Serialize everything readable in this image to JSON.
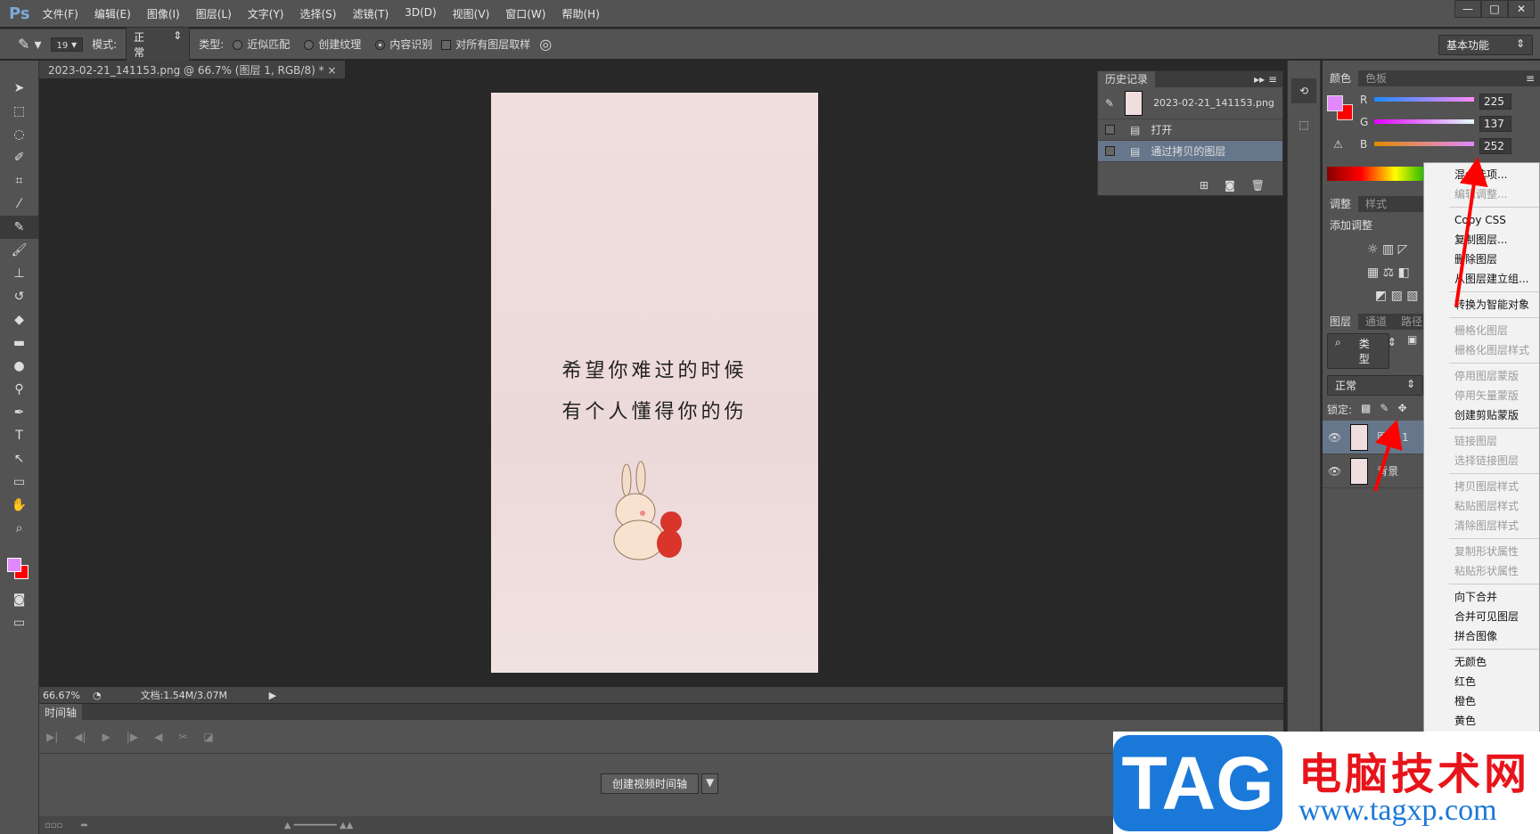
{
  "app": {
    "logo": "Ps",
    "menu": [
      "文件(F)",
      "编辑(E)",
      "图像(I)",
      "图层(L)",
      "文字(Y)",
      "选择(S)",
      "滤镜(T)",
      "3D(D)",
      "视图(V)",
      "窗口(W)",
      "帮助(H)"
    ],
    "window_buttons": [
      "—",
      "□",
      "✕"
    ]
  },
  "options": {
    "brush_size": "19",
    "mode_label": "模式:",
    "mode_value": "正常",
    "type_label": "类型:",
    "radios": [
      {
        "label": "近似匹配",
        "checked": false
      },
      {
        "label": "创建纹理",
        "checked": false
      },
      {
        "label": "内容识别",
        "checked": true
      }
    ],
    "sample_all_label": "对所有图层取样",
    "workspace": "基本功能"
  },
  "document": {
    "tab_title": "2023-02-21_141153.png @ 66.7% (图层 1, RGB/8) *",
    "close": "×",
    "poem_line1": "希望你难过的时候",
    "poem_line2": "有个人懂得你的伤"
  },
  "status": {
    "zoom": "66.67%",
    "doc_size": "文档:1.54M/3.07M"
  },
  "timeline": {
    "tab": "时间轴",
    "create_button": "创建视频时间轴"
  },
  "history": {
    "tab": "历史记录",
    "snapshot": "2023-02-21_141153.png",
    "items": [
      "打开",
      "通过拷贝的图层"
    ]
  },
  "color": {
    "tabs": [
      "颜色",
      "色板"
    ],
    "fg": "#e189fc",
    "bg": "#ff0000",
    "channels": [
      {
        "label": "R",
        "value": "225"
      },
      {
        "label": "G",
        "value": "137"
      },
      {
        "label": "B",
        "value": "252"
      }
    ]
  },
  "adjust": {
    "tabs": [
      "调整",
      "样式"
    ],
    "title": "添加调整"
  },
  "layers": {
    "tabs": [
      "图层",
      "通道",
      "路径"
    ],
    "filter": "类型",
    "blend": "正常",
    "lock_label": "锁定:",
    "items": [
      {
        "name": "图层 1",
        "selected": true
      },
      {
        "name": "背景",
        "selected": false
      }
    ]
  },
  "context_menu": [
    {
      "label": "混合选项...",
      "disabled": false
    },
    {
      "label": "编辑调整...",
      "disabled": true
    },
    {
      "sep": true
    },
    {
      "label": "Copy CSS",
      "disabled": false
    },
    {
      "label": "复制图层...",
      "disabled": false
    },
    {
      "label": "删除图层",
      "disabled": false
    },
    {
      "label": "从图层建立组...",
      "disabled": false
    },
    {
      "sep": true
    },
    {
      "label": "转换为智能对象",
      "disabled": false
    },
    {
      "sep": true
    },
    {
      "label": "栅格化图层",
      "disabled": true
    },
    {
      "label": "栅格化图层样式",
      "disabled": true
    },
    {
      "sep": true
    },
    {
      "label": "停用图层蒙版",
      "disabled": true
    },
    {
      "label": "停用矢量蒙版",
      "disabled": true
    },
    {
      "label": "创建剪贴蒙版",
      "disabled": false
    },
    {
      "sep": true
    },
    {
      "label": "链接图层",
      "disabled": true
    },
    {
      "label": "选择链接图层",
      "disabled": true
    },
    {
      "sep": true
    },
    {
      "label": "拷贝图层样式",
      "disabled": true
    },
    {
      "label": "粘贴图层样式",
      "disabled": true
    },
    {
      "label": "清除图层样式",
      "disabled": true
    },
    {
      "sep": true
    },
    {
      "label": "复制形状属性",
      "disabled": true
    },
    {
      "label": "粘贴形状属性",
      "disabled": true
    },
    {
      "sep": true
    },
    {
      "label": "向下合并",
      "disabled": false
    },
    {
      "label": "合并可见图层",
      "disabled": false
    },
    {
      "label": "拼合图像",
      "disabled": false
    },
    {
      "sep": true
    },
    {
      "label": "无颜色",
      "disabled": false
    },
    {
      "label": "红色",
      "disabled": false
    },
    {
      "label": "橙色",
      "disabled": false
    },
    {
      "label": "黄色",
      "disabled": false
    }
  ],
  "watermark": {
    "logo": "TAG",
    "text": "电脑技术网",
    "url": "www.tagxp.com"
  },
  "tools": [
    "move-tool",
    "marquee-tool",
    "lasso-tool",
    "quick-select-tool",
    "crop-tool",
    "eyedropper-tool",
    "healing-brush-tool",
    "brush-tool",
    "stamp-tool",
    "history-brush-tool",
    "eraser-tool",
    "gradient-tool",
    "blur-tool",
    "dodge-tool",
    "pen-tool",
    "type-tool",
    "path-select-tool",
    "shape-tool",
    "hand-tool",
    "zoom-tool"
  ]
}
